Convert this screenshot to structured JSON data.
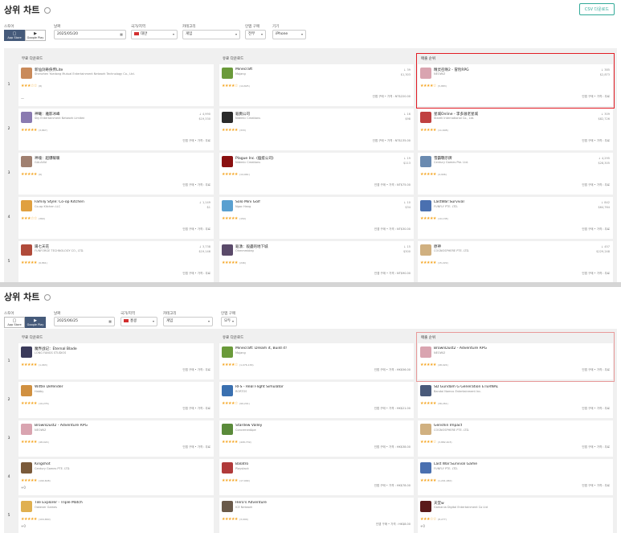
{
  "panels": [
    {
      "title": "상위 차트",
      "csv_label": "CSV 다운로드",
      "filters": {
        "store_label": "스토어",
        "stores": [
          "App Store",
          "Google Play"
        ],
        "active_store": 0,
        "date_label": "날짜",
        "date_value": "2025/05/20",
        "country_label": "국가/지역",
        "country_value": "대만",
        "category_label": "카테고리",
        "category_value": "게임",
        "purchase_label": "인앱 구매",
        "purchase_value": "전부",
        "device_label": "기기",
        "device_value": "iPhone"
      },
      "columns": [
        "무료 다운로드",
        "유료 다운로드",
        "매출 순위"
      ],
      "ranks": [
        "1",
        "2",
        "3",
        "4",
        "5"
      ],
      "rows": [
        [
          {
            "name": "新仙剑奇侠传Lite",
            "pub": "Shenzhen Yuedong Mutual Entertainment Network Technology Co., Ltd.",
            "stars": "★★★☆☆",
            "count": "(8)",
            "stat1": "",
            "stat2": "",
            "tags": "",
            "dash": "—",
            "color": "#c98a5a"
          },
          {
            "name": "Minecraft",
            "pub": "Mojang",
            "stars": "★★★★☆",
            "count": "(14,825)",
            "stat1": "↓ 39",
            "stat2": "$1,303",
            "tags": "인앱 구매 • 가격 : NT$220.00",
            "dash": "",
            "color": "#6a9a3a"
          },
          {
            "name": "精灵召唤2 - 冒险RPG",
            "pub": "NEOWIZ",
            "stars": "★★★★☆",
            "count": "(5,883)",
            "stat1": "↓ 385",
            "stat2": "$2,873",
            "tags": "인앱 구매 • 가격 : 무료",
            "dash": "",
            "color": "#d9a4b0"
          }
        ],
        [
          {
            "name": "神曦：雅影冰峰",
            "pub": "Sky Entertainment Network Limited",
            "stars": "★★★★★",
            "count": "(3,867)",
            "stat1": "↓ 4,990",
            "stat2": "$19,330",
            "tags": "인앱 구매 • 가격 : 무료",
            "dash": "",
            "color": "#8a7ab0"
          },
          {
            "name": "殺戮公司",
            "pub": "Ndemic Creations",
            "stars": "★★★★★",
            "count": "(333)",
            "stat1": "↓ 16",
            "stat2": "$98",
            "tags": "인앱 구매 • 가격 : NT$135.00",
            "dash": "",
            "color": "#2a2a2a"
          },
          {
            "name": "星城Online - 李多滋老星城",
            "pub": "Starek International Co., Ltd.",
            "stars": "★★★★★",
            "count": "(11,608)",
            "stat1": "↓ 309",
            "stat2": "$82,726",
            "tags": "인앱 구매 • 가격 : 무료",
            "dash": "",
            "color": "#c04040"
          }
        ],
        [
          {
            "name": "神魂：超爆暖暖",
            "pub": "GALAXIA",
            "stars": "★★★★★",
            "count": "(6)",
            "stat1": "",
            "stat2": "",
            "tags": "인앱 구매 • 가격 : 무료",
            "dash": "",
            "color": "#a08070"
          },
          {
            "name": "Plague Inc. (瘟疫公司)",
            "pub": "Ndemic Creations",
            "stars": "★★★★★",
            "count": "(14,961)",
            "stat1": "↓ 19",
            "stat2": "$113",
            "tags": "인앱 구매 • 가격 : NT$75.00",
            "dash": "",
            "color": "#8a1010"
          },
          {
            "name": "雪霸戰示牌",
            "pub": "Century Games Pte. Ltd.",
            "stars": "★★★★★",
            "count": "(4,906)",
            "stat1": "↓ 4,295",
            "stat2": "$28,305",
            "tags": "인앱 구매 • 가격 : 무료",
            "dash": "",
            "color": "#6a8ab0"
          }
        ],
        [
          {
            "name": "Family Style: Co-op Kitchen",
            "pub": "Co-op Kitchen LLC",
            "stars": "★★★☆☆",
            "count": "(360)",
            "stat1": "↓ 1,149",
            "stat2": "$1",
            "tags": "인앱 구매 • 가격 : 무료",
            "dash": "",
            "color": "#e0a040"
          },
          {
            "name": "Solo Mini Golf",
            "pub": "Ngoc Hang",
            "stars": "★★★★★",
            "count": "(150)",
            "stat1": "↓ 10",
            "stat2": "$34",
            "tags": "인앱 구매 • 가격 : NT$30.00",
            "dash": "",
            "color": "#5aa0d0"
          },
          {
            "name": "LastWar:Survival",
            "pub": "FUNFLY PTE. LTD.",
            "stars": "★★★★★",
            "count": "(10,138)",
            "stat1": "↓ 842",
            "stat2": "$64,764",
            "tags": "인앱 구매 • 가격 : 무료",
            "dash": "",
            "color": "#4a70b0"
          }
        ],
        [
          {
            "name": "陽七天花",
            "pub": "FUNFORGE TECHNOLOGY CO., LTD.",
            "stars": "★★★★★",
            "count": "(6,861)",
            "stat1": "↓ 3,738",
            "stat2": "$19,146",
            "tags": "인앱 구매 • 가격 : 무료",
            "dash": "",
            "color": "#b04a3a"
          },
          {
            "name": "殺湧：殺盡的地下城",
            "pub": "Ohmmmbleg",
            "stars": "★★★★★",
            "count": "(246)",
            "stat1": "↓ 15",
            "stat2": "$300",
            "tags": "인앱 구매 • 가격 : NT$90.00",
            "dash": "",
            "color": "#5a4a6a"
          },
          {
            "name": "原神",
            "pub": "COGNOSPHERE PTE. LTD.",
            "stars": "★★★★★",
            "count": "(15,229)",
            "stat1": "↓ 457",
            "stat2": "$229,248",
            "tags": "인앱 구매 • 가격 : 무료",
            "dash": "",
            "color": "#d0b080"
          }
        ]
      ]
    },
    {
      "title": "상위 차트",
      "csv_label": "",
      "filters": {
        "store_label": "스토어",
        "stores": [
          "App Store",
          "Google Play"
        ],
        "active_store": 1,
        "date_label": "날짜",
        "date_value": "2025/06/25",
        "country_label": "국가/지역",
        "country_value": "홍콩",
        "category_label": "카테고리",
        "category_value": "게임",
        "purchase_label": "인앱 구매",
        "purchase_value": "모두",
        "device_label": "",
        "device_value": ""
      },
      "columns": [
        "무료 다운로드",
        "유료 다운로드",
        "매출 순위"
      ],
      "ranks": [
        "1",
        "2",
        "3",
        "4",
        "5"
      ],
      "rows": [
        [
          {
            "name": "魔界战记：Eternal Blade",
            "pub": "LONG FANGS STUDIOS",
            "stars": "★★★★★",
            "count": "(1,063)",
            "stat1": "",
            "stat2": "",
            "tags": "인앱 구매 • 가격 : 무료",
            "dash": "",
            "color": "#3a3a5a"
          },
          {
            "name": "Minecraft: Dream it, Build it!",
            "pub": "Mojang",
            "stars": "★★★★☆",
            "count": "(1,076,136)",
            "stat1": "",
            "stat2": "",
            "tags": "인앱 구매 • 가격 : HK$56.00",
            "dash": "",
            "color": "#6a9a3a"
          },
          {
            "name": "BrownDust2 - Adventure RPG",
            "pub": "NEOWIZ",
            "stars": "★★★★★",
            "count": "(48,024)",
            "stat1": "",
            "stat2": "",
            "tags": "인앱 구매 • 가격 : 무료",
            "dash": "",
            "color": "#d9a4b0"
          }
        ],
        [
          {
            "name": "Wittle Defender",
            "pub": "Habby",
            "stars": "★★★★★",
            "count": "(19,276)",
            "stat1": "",
            "stat2": "",
            "tags": "인앱 구매 • 가격 : 무료",
            "dash": "",
            "color": "#d09040"
          },
          {
            "name": "RFS - Real Flight Simulator",
            "pub": "RORTOS",
            "stars": "★★★★☆",
            "count": "(99,201)",
            "stat1": "",
            "stat2": "",
            "tags": "인앱 구매 • 가격 : HK$21.00",
            "dash": "",
            "color": "#3a70b0"
          },
          {
            "name": "SD Gundam G Generation ETERNAL",
            "pub": "Bandai Namco Entertainment Inc.",
            "stars": "★★★★★",
            "count": "(36,261)",
            "stat1": "",
            "stat2": "",
            "tags": "인앱 구매 • 가격 : 무료",
            "dash": "",
            "color": "#4a5a7a"
          }
        ],
        [
          {
            "name": "BrownDust2 - Adventure RPG",
            "pub": "NEOWIZ",
            "stars": "★★★★★",
            "count": "(48,024)",
            "stat1": "",
            "stat2": "",
            "tags": "인앱 구매 • 가격 : 무료",
            "dash": "",
            "color": "#d9a4b0"
          },
          {
            "name": "Stardew Valley",
            "pub": "ConcernedApe",
            "stars": "★★★★★",
            "count": "(408,739)",
            "stat1": "",
            "stat2": "",
            "tags": "인앱 구매 • 가격 : HK$38.00",
            "dash": "",
            "color": "#5a8a3a"
          },
          {
            "name": "Genshin Impact",
            "pub": "COGNOSPHERE PTE. LTD.",
            "stars": "★★★★☆",
            "count": "(3,882,403)",
            "stat1": "",
            "stat2": "",
            "tags": "인앱 구매 • 가격 : 무료",
            "dash": "",
            "color": "#d0b080"
          }
        ],
        [
          {
            "name": "Kingshot",
            "pub": "Century Games PTE. LTD.",
            "stars": "★★★★★",
            "count": "(190,608)",
            "stat1": "",
            "stat2": "",
            "tags": "",
            "dash": "+0",
            "color": "#7a5a3a"
          },
          {
            "name": "Balatro",
            "pub": "Playstack",
            "stars": "★★★★★",
            "count": "(17,999)",
            "stat1": "",
            "stat2": "",
            "tags": "인앱 구매 • 가격 : HK$78.00",
            "dash": "",
            "color": "#b03a3a"
          },
          {
            "name": "Last War:Survival Game",
            "pub": "FUNFLY PTE. LTD.",
            "stars": "★★★★★",
            "count": "(1,201,060)",
            "stat1": "",
            "stat2": "",
            "tags": "인앱 구매 • 가격 : 무료",
            "dash": "",
            "color": "#4a70b0"
          }
        ],
        [
          {
            "name": "Tile Explorer - Triple Match",
            "pub": "Oakever Games",
            "stars": "★★★★★",
            "count": "(104,660)",
            "stat1": "",
            "stat2": "",
            "tags": "",
            "dash": "+0",
            "color": "#e0b050"
          },
          {
            "name": "Hero's Adventure",
            "pub": "ICE Network",
            "stars": "★★★★★",
            "count": "(3,090)",
            "stat1": "",
            "stat2": "",
            "tags": "인앱 구매 • 가격 : HK$8.00",
            "dash": "",
            "color": "#6a5a4a"
          },
          {
            "name": "天堂w",
            "pub": "Gamania Digital Entertainment Co Ltd",
            "stars": "★★★☆☆",
            "count": "(8,277)",
            "stat1": "",
            "stat2": "",
            "tags": "",
            "dash": "+0",
            "color": "#5a1a1a"
          }
        ]
      ]
    }
  ]
}
